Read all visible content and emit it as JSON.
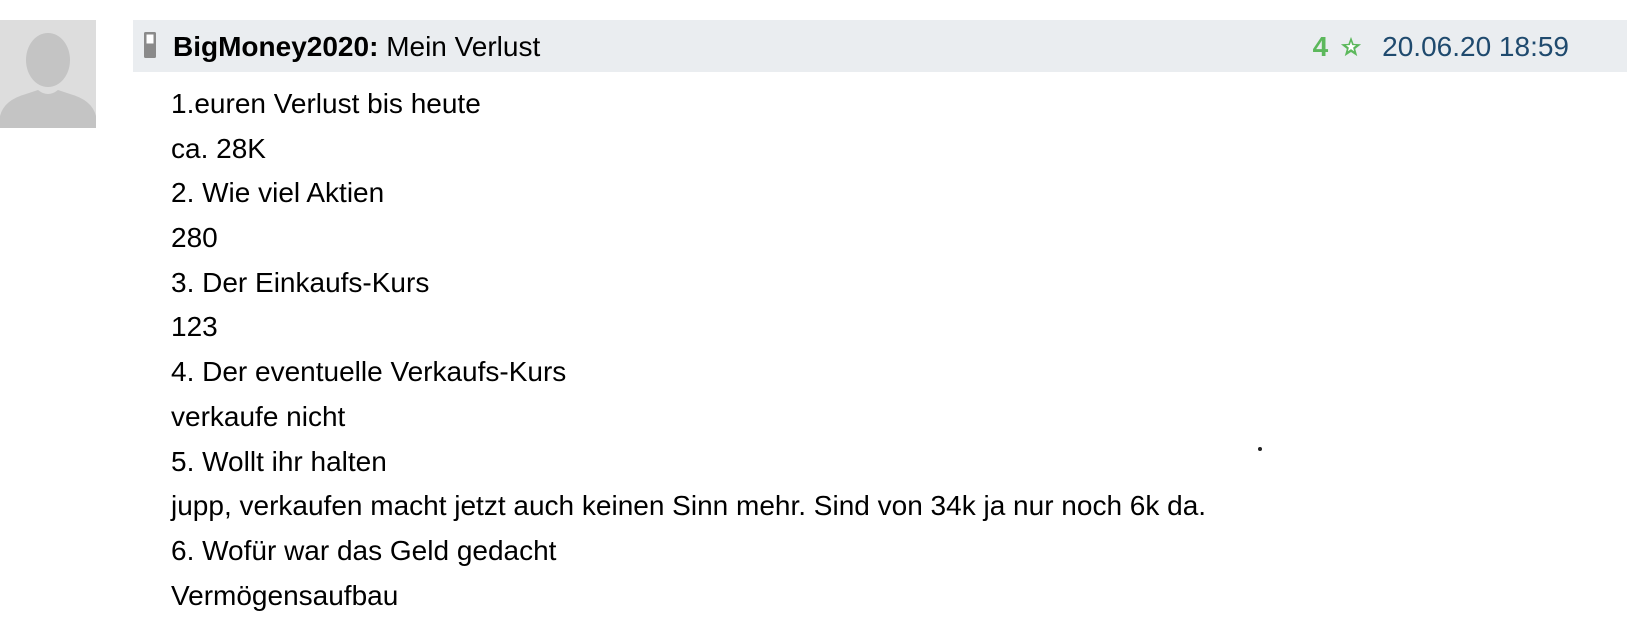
{
  "avatar": {
    "icon": "user-silhouette-icon"
  },
  "header": {
    "device_icon": "mobile-phone-icon",
    "author": "BigMoney2020:",
    "title": "Mein Verlust",
    "rating_count": "4",
    "rating_icon": "star-icon",
    "date": "20.06.20 18:59"
  },
  "body": {
    "lines": [
      "1.euren Verlust bis heute",
      "ca. 28K",
      "2. Wie viel Aktien",
      "280",
      "3. Der Einkaufs-Kurs",
      "123",
      "4. Der eventuelle Verkaufs-Kurs",
      "verkaufe nicht",
      "5. Wollt ihr halten",
      "jupp, verkaufen macht jetzt auch keinen Sinn mehr. Sind von 34k ja nur noch 6k da.",
      "6. Wofür war das Geld gedacht",
      "Vermögensaufbau"
    ]
  },
  "colors": {
    "header_bg": "#eaedf0",
    "rating": "#5cb85c",
    "date": "#1f4a6e",
    "avatar_bg": "#dddddd"
  }
}
